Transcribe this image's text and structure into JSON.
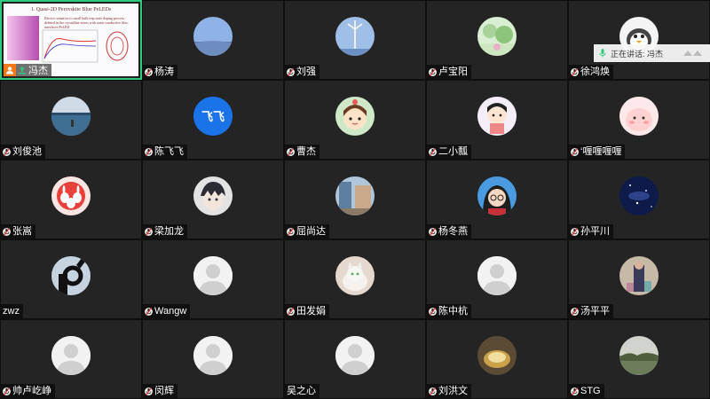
{
  "speaking": {
    "text": "正在讲话: 冯杰"
  },
  "slide": {
    "title": "1. Quasi-2D Perovskite Blue PeLEDs",
    "note": "Electric sensitive to small bulk trap state doping process - defined in the crystalline zones with some conductive film; interfaces PeLED."
  },
  "colors": {
    "active_border": "#2ec97d",
    "tile_bg": "#242424",
    "host_badge": "#f07a1a",
    "avatar_blue": "#1a73e8"
  },
  "participants": [
    {
      "name": "冯杰",
      "avatar": "slide-share",
      "host": true
    },
    {
      "name": "杨涛",
      "avatar": "photo-sky-blue"
    },
    {
      "name": "刘强",
      "avatar": "photo-windmill"
    },
    {
      "name": "卢宝阳",
      "avatar": "photo-garden"
    },
    {
      "name": "徐鸿焕",
      "avatar": "cartoon-penguin"
    },
    {
      "name": "刘俊池",
      "avatar": "photo-lake"
    },
    {
      "name": "陈飞飞",
      "avatar": "text",
      "avatar_text": "飞飞"
    },
    {
      "name": "曹杰",
      "avatar": "cartoon-girl"
    },
    {
      "name": "二小瓢",
      "avatar": "cartoon-chibi"
    },
    {
      "name": "‘喱喱喱喱",
      "avatar": "cartoon-pink"
    },
    {
      "name": "张嵩",
      "avatar": "cartoon-rabbits"
    },
    {
      "name": "梁加龙",
      "avatar": "anime-boy"
    },
    {
      "name": "屈尚达",
      "avatar": "photo-street"
    },
    {
      "name": "杨冬燕",
      "avatar": "cartoon-woman-glasses"
    },
    {
      "name": "孙平川",
      "avatar": "photo-galaxy"
    },
    {
      "name": "zwz",
      "avatar": "photo-hand-ok",
      "no_mic": true
    },
    {
      "name": "Wangw",
      "avatar": "default"
    },
    {
      "name": "田发娟",
      "avatar": "photo-cat"
    },
    {
      "name": "陈中杭",
      "avatar": "default"
    },
    {
      "name": "汤平平",
      "avatar": "photo-person"
    },
    {
      "name": "帅卢屹峥",
      "avatar": "default"
    },
    {
      "name": "闵辉",
      "avatar": "default"
    },
    {
      "name": "吴之心",
      "avatar": "default",
      "no_mic": true
    },
    {
      "name": "刘洪文",
      "avatar": "photo-shell"
    },
    {
      "name": "STG",
      "avatar": "photo-landscape"
    }
  ]
}
